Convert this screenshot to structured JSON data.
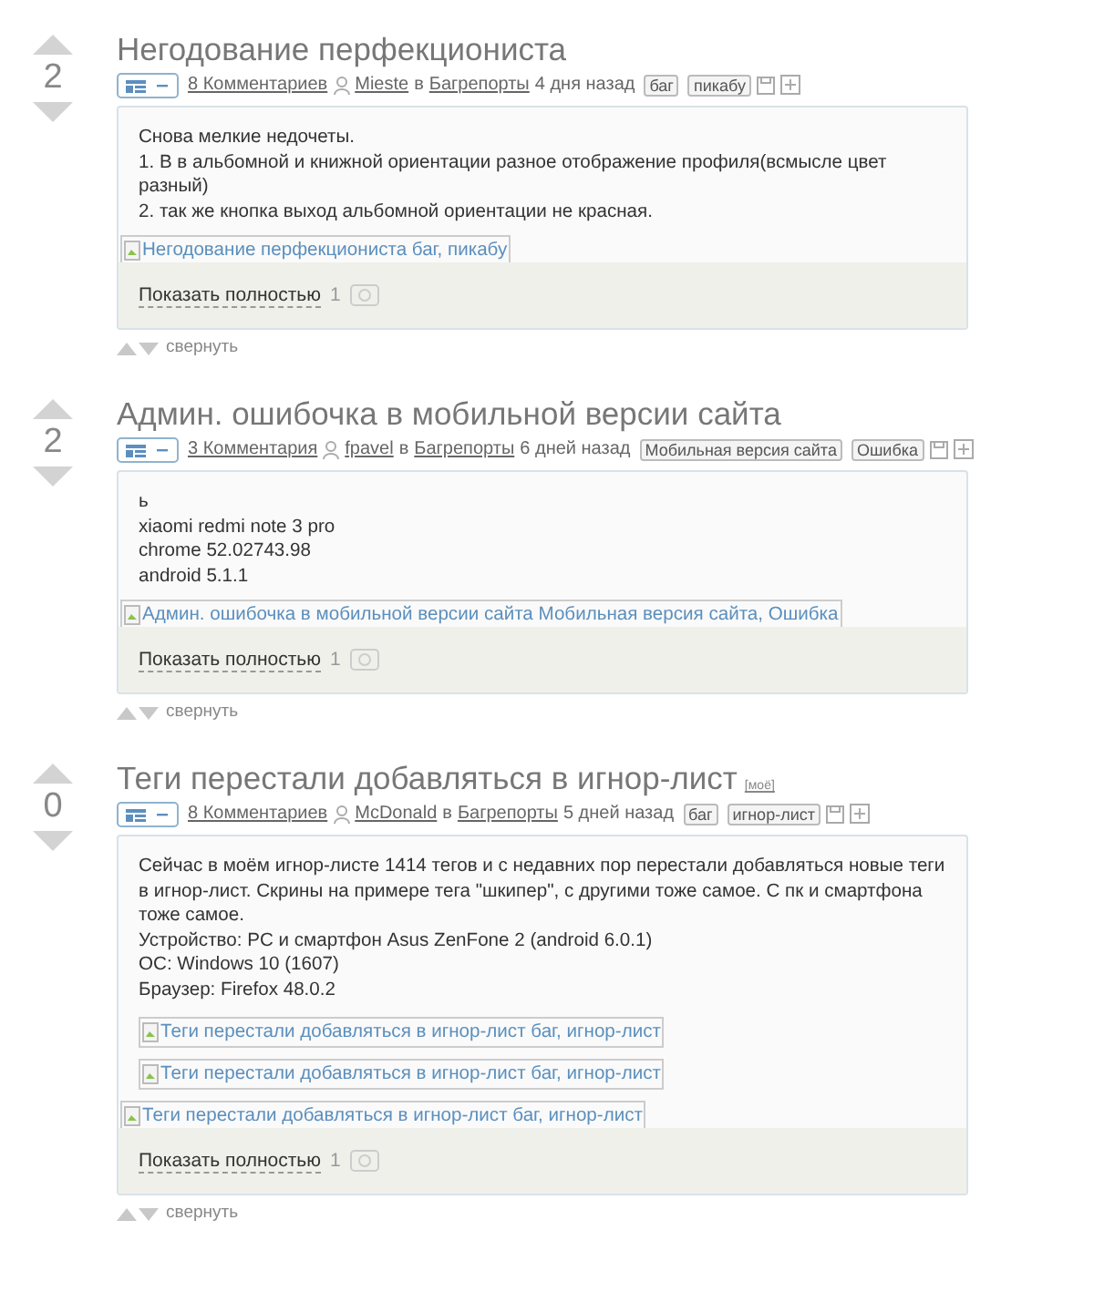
{
  "posts": [
    {
      "rating": "2",
      "title": "Негодование перфекциониста",
      "comments": "8 Комментариев",
      "author": "Mieste",
      "in": "в",
      "community": "Багрепорты",
      "time": "4 дня назад",
      "tags": [
        "баг",
        "пикабу"
      ],
      "body": [
        "Снова мелкие недочеты.",
        "1. В в альбомной и книжной ориентации разное отображение профиля(всмысле цвет разный)",
        "2. так же кнопка выход  альбомной ориентации не красная."
      ],
      "images": [
        {
          "alt": "Негодование перфекциониста баг, пикабу",
          "kind": "edge"
        }
      ],
      "show_full": "Показать полностью",
      "photo_count": "1",
      "collapse": "свернуть"
    },
    {
      "rating": "2",
      "title": "Админ. ошибочка в мобильной версии сайта",
      "comments": "3 Комментария",
      "author": "fpavel",
      "in": "в",
      "community": "Багрепорты",
      "time": "6 дней назад",
      "tags": [
        "Мобильная версия сайта",
        "Ошибка"
      ],
      "body": [
        "ь",
        "xiaomi redmi note 3 pro",
        "chrome 52.02743.98",
        "android 5.1.1"
      ],
      "images": [
        {
          "alt": "Админ. ошибочка в мобильной версии сайта Мобильная версия сайта, Ошибка",
          "kind": "edge"
        }
      ],
      "show_full": "Показать полностью",
      "photo_count": "1",
      "collapse": "свернуть"
    },
    {
      "rating": "0",
      "title": "Теги перестали добавляться в игнор-лист",
      "badge": "[моё]",
      "comments": "8 Комментариев",
      "author": "McDonald",
      "in": "в",
      "community": "Багрепорты",
      "time": "5 дней назад",
      "tags": [
        "баг",
        "игнор-лист"
      ],
      "body": [
        "Сейчас в моём игнор-листе 1414 тегов и с недавних пор перестали добавляться новые теги в игнор-лист. Скрины на примере тега \"шкипер\", с другими тоже самое. С пк и смартфона тоже самое.",
        "Устройство: PC и смартфон Asus ZenFone 2 (android 6.0.1)",
        "ОС: Windows 10 (1607)",
        "Браузер: Firefox 48.0.2"
      ],
      "images": [
        {
          "alt": "Теги перестали добавляться в игнор-лист баг, игнор-лист",
          "kind": "inset"
        },
        {
          "alt": "Теги перестали добавляться в игнор-лист баг, игнор-лист",
          "kind": "inset"
        },
        {
          "alt": "Теги перестали добавляться в игнор-лист баг, игнор-лист",
          "kind": "edge"
        }
      ],
      "show_full": "Показать полностью",
      "photo_count": "1",
      "collapse": "свернуть"
    }
  ]
}
